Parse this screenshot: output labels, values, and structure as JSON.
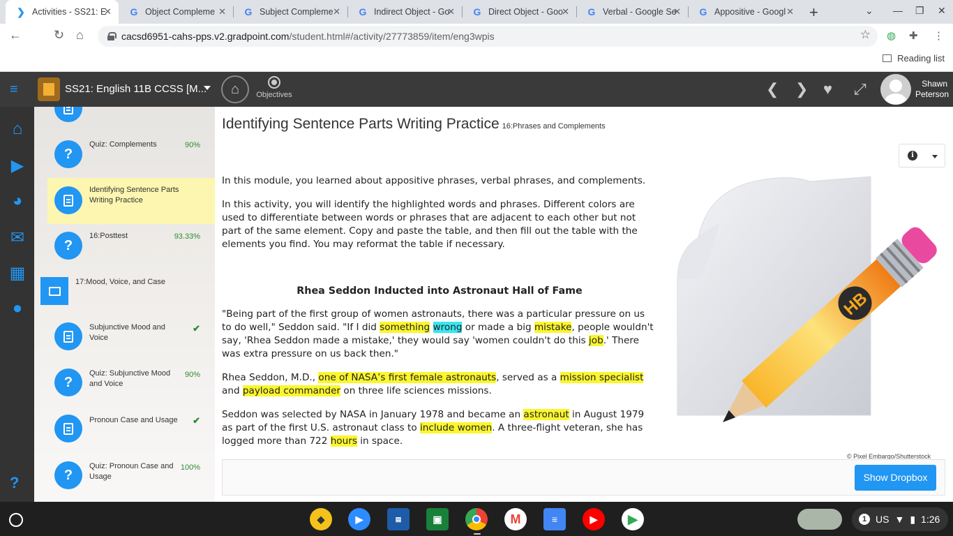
{
  "browser": {
    "tabs": [
      {
        "title": "Activities - SS21: E",
        "favicon": "gradpoint-icon",
        "active": true
      },
      {
        "title": "Object Compleme",
        "favicon": "google-icon",
        "active": false
      },
      {
        "title": "Subject Compleme",
        "favicon": "google-icon",
        "active": false
      },
      {
        "title": "Indirect Object - Go",
        "favicon": "google-icon",
        "active": false
      },
      {
        "title": "Direct Object - Goo",
        "favicon": "google-icon",
        "active": false
      },
      {
        "title": "Verbal - Google Se",
        "favicon": "google-icon",
        "active": false
      },
      {
        "title": "Appositive - Googl",
        "favicon": "google-icon",
        "active": false
      }
    ],
    "url_host": "cacsd6951-cahs-pps.v2.gradpoint.com",
    "url_path": "/student.html#/activity/27773859/item/eng3wpis",
    "reading_list": "Reading list"
  },
  "app": {
    "course_title": "SS21: English 11B CCSS [M...",
    "objectives_label": "Objectives",
    "user_first": "Shawn",
    "user_last": "Peterson"
  },
  "activities": [
    {
      "label": "Quiz: Complements",
      "score": "90%",
      "kind": "quiz"
    },
    {
      "label": "Identifying Sentence Parts Writing Practice",
      "score": "",
      "kind": "doc",
      "selected": true
    },
    {
      "label": "16:Posttest",
      "score": "93.33%",
      "kind": "quiz"
    },
    {
      "label": "17:Mood, Voice, and Case",
      "score": "",
      "kind": "folder"
    },
    {
      "label": "Subjunctive Mood and Voice",
      "score": "✔",
      "kind": "doc"
    },
    {
      "label": "Quiz: Subjunctive Mood and Voice",
      "score": "90%",
      "kind": "quiz"
    },
    {
      "label": "Pronoun Case and Usage",
      "score": "✔",
      "kind": "doc"
    },
    {
      "label": "Quiz: Pronoun Case and Usage",
      "score": "100%",
      "kind": "quiz"
    }
  ],
  "content": {
    "title": "Identifying Sentence Parts Writing Practice",
    "subtitle": "16:Phrases and Complements",
    "intro1": "In this module, you learned about appositive phrases, verbal phrases, and complements.",
    "intro2": "In this activity, you will identify the highlighted words and phrases. Different colors are used to differentiate between words or phrases that are adjacent to each other but not part of the same element. Copy and paste the table, and then fill out the table with the elements you find. You may reformat the table if necessary.",
    "heading": "Rhea Seddon Inducted into Astronaut Hall of Fame",
    "p1": [
      "\"Being part of the first group of women astronauts, there was a particular pressure on us to do well,\" Seddon said. \"If I did ",
      "something",
      " ",
      "wrong",
      " or made a big ",
      "mistake",
      ", people wouldn't say, 'Rhea Seddon made a mistake,' they would say 'women couldn't do this ",
      "job",
      ".' There was extra pressure on us back then.\""
    ],
    "p2": [
      "Rhea Seddon, M.D., ",
      "one of NASA’s first female astronauts",
      ", served as a ",
      "mission specialist",
      " and ",
      "payload commander",
      " on three life sciences missions."
    ],
    "p3": [
      "Seddon was selected by NASA in January 1978 and became an ",
      "astronaut",
      " in August 1979 as part of the first U.S. astronaut class to ",
      "include women",
      ". A three-flight veteran, she has logged more than 722 ",
      "hours",
      " in space."
    ],
    "image_credit": "© Pixel Embargo/Shutterstock",
    "dropbox_button": "Show Dropbox",
    "highlight_yellow": "#fbf62e",
    "highlight_cyan": "#38e7ef"
  },
  "shelf": {
    "time": "1:26",
    "locale": "US",
    "notification_count": "1"
  }
}
